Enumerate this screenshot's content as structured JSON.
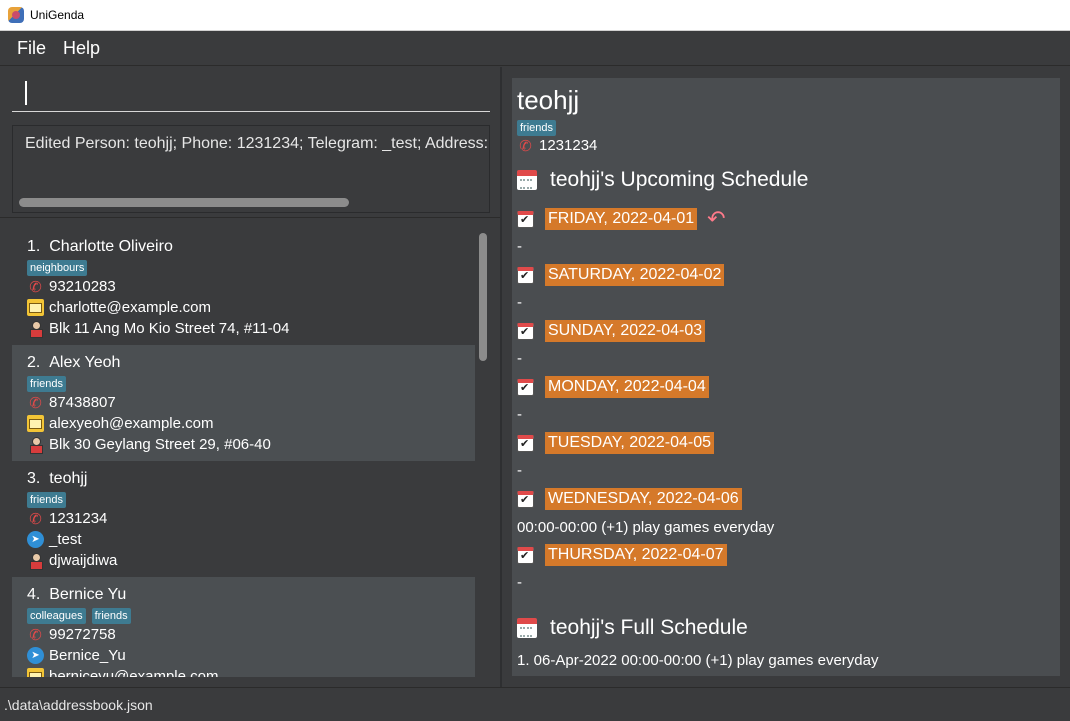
{
  "window": {
    "title": "UniGenda"
  },
  "menu": {
    "items": [
      "File",
      "Help"
    ]
  },
  "command": {
    "value": ""
  },
  "result": {
    "text": "Edited Person: teohjj; Phone: 1231234; Telegram: _test; Address:"
  },
  "persons": [
    {
      "index": "1.",
      "name": "Charlotte Oliveiro",
      "tags": [
        "neighbours"
      ],
      "phone": "93210283",
      "email": "charlotte@example.com",
      "address": "Blk 11 Ang Mo Kio Street 74, #11-04"
    },
    {
      "index": "2.",
      "name": "Alex Yeoh",
      "tags": [
        "friends"
      ],
      "phone": "87438807",
      "email": "alexyeoh@example.com",
      "address": "Blk 30 Geylang Street 29, #06-40"
    },
    {
      "index": "3.",
      "name": "teohjj",
      "tags": [
        "friends"
      ],
      "phone": "1231234",
      "telegram": "_test",
      "address": "djwaijdiwa"
    },
    {
      "index": "4.",
      "name": "Bernice Yu",
      "tags": [
        "colleagues",
        "friends"
      ],
      "phone": "99272758",
      "telegram": "Bernice_Yu",
      "email": "berniceyu@example.com"
    }
  ],
  "detail": {
    "name": "teohjj",
    "tag": "friends",
    "phone": "1231234",
    "upcoming_title": "teohjj's Upcoming Schedule",
    "days": [
      {
        "label": "FRIDAY, 2022-04-01",
        "entry": "-"
      },
      {
        "label": "SATURDAY, 2022-04-02",
        "entry": "-"
      },
      {
        "label": "SUNDAY, 2022-04-03",
        "entry": "-"
      },
      {
        "label": "MONDAY, 2022-04-04",
        "entry": "-"
      },
      {
        "label": "TUESDAY, 2022-04-05",
        "entry": "-"
      },
      {
        "label": "WEDNESDAY, 2022-04-06",
        "entry": "00:00-00:00 (+1)  play games everyday"
      },
      {
        "label": "THURSDAY, 2022-04-07",
        "entry": "-"
      }
    ],
    "full_title": "teohjj's Full Schedule",
    "full_entries": [
      "1. 06-Apr-2022 00:00-00:00 (+1)  play games everyday"
    ]
  },
  "status": {
    "path": ".\\data\\addressbook.json"
  },
  "icons": {
    "app": "unigenda-logo-icon",
    "phone": "phone-icon",
    "email": "email-icon",
    "telegram": "telegram-icon",
    "address": "address-icon",
    "calendar": "calendar-icon",
    "back": "back-arrow-icon"
  },
  "colors": {
    "tag": "#3e7b91",
    "day_highlight": "#d5792a",
    "background": "#3a3b3d",
    "panel": "#4a4d50"
  }
}
